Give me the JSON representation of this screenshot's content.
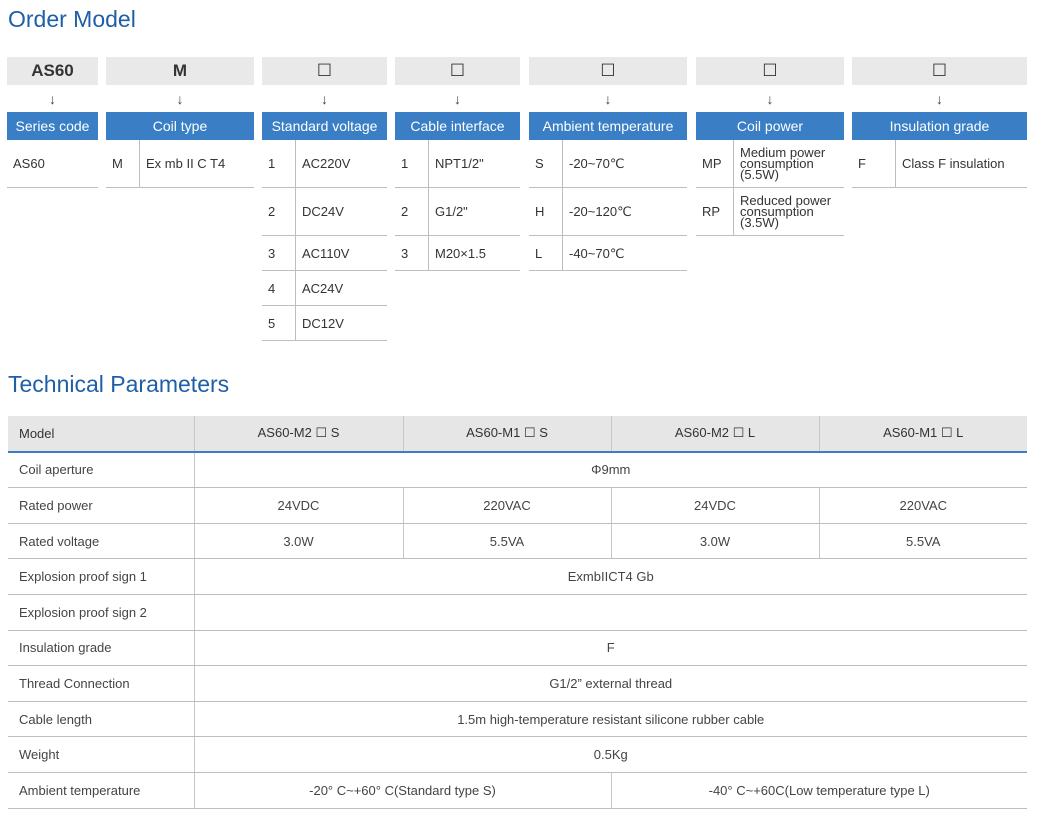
{
  "order_model": {
    "title": "Order Model",
    "arrow": "↓",
    "columns": [
      {
        "code": "AS60",
        "header": "Series code",
        "options": [
          {
            "code": "AS60",
            "desc": ""
          }
        ]
      },
      {
        "code": "M",
        "header": "Coil type",
        "options": [
          {
            "code": "M",
            "desc": "Ex mb II C T4"
          }
        ]
      },
      {
        "code": "☐",
        "header": "Standard voltage",
        "options": [
          {
            "code": "1",
            "desc": "AC220V"
          },
          {
            "code": "2",
            "desc": "DC24V"
          },
          {
            "code": "3",
            "desc": "AC110V"
          },
          {
            "code": "4",
            "desc": "AC24V"
          },
          {
            "code": "5",
            "desc": "DC12V"
          }
        ]
      },
      {
        "code": "☐",
        "header": "Cable interface",
        "options": [
          {
            "code": "1",
            "desc": "NPT1/2\""
          },
          {
            "code": "2",
            "desc": "G1/2\""
          },
          {
            "code": "3",
            "desc": "M20×1.5"
          }
        ]
      },
      {
        "code": "☐",
        "header": "Ambient temperature",
        "options": [
          {
            "code": "S",
            "desc": "-20~70℃"
          },
          {
            "code": "H",
            "desc": "-20~120℃"
          },
          {
            "code": "L",
            "desc": "-40~70℃"
          }
        ]
      },
      {
        "code": "☐",
        "header": "Coil power",
        "options": [
          {
            "code": "MP",
            "desc_lines": [
              "Medium power",
              "consumption",
              "(5.5W)"
            ]
          },
          {
            "code": "RP",
            "desc_lines": [
              "Reduced power",
              "consumption",
              "(3.5W)"
            ]
          }
        ]
      },
      {
        "code": "☐",
        "header": "Insulation grade",
        "options": [
          {
            "code": "F",
            "desc": "Class F insulation"
          }
        ]
      }
    ]
  },
  "technical": {
    "title": "Technical Parameters",
    "header": [
      "Model",
      "AS60-M2 ☐ S",
      "AS60-M1 ☐ S",
      "AS60-M2 ☐ L",
      "AS60-M1 ☐ L"
    ],
    "rows": [
      {
        "label": "Coil aperture",
        "cells": [
          {
            "text": "Φ9mm",
            "span": 4
          }
        ]
      },
      {
        "label": "Rated power",
        "cells": [
          {
            "text": "24VDC",
            "span": 1
          },
          {
            "text": "220VAC",
            "span": 1
          },
          {
            "text": "24VDC",
            "span": 1
          },
          {
            "text": "220VAC",
            "span": 1
          }
        ]
      },
      {
        "label": "Rated voltage",
        "cells": [
          {
            "text": "3.0W",
            "span": 1
          },
          {
            "text": "5.5VA",
            "span": 1
          },
          {
            "text": "3.0W",
            "span": 1
          },
          {
            "text": "5.5VA",
            "span": 1
          }
        ]
      },
      {
        "label": "Explosion proof sign 1",
        "cells": [
          {
            "text": "ExmbIICT4 Gb",
            "span": 4
          }
        ]
      },
      {
        "label": "Explosion proof sign 2",
        "cells": [
          {
            "text": "",
            "span": 4
          }
        ]
      },
      {
        "label": "Insulation grade",
        "cells": [
          {
            "text": "F",
            "span": 4
          }
        ]
      },
      {
        "label": "Thread Connection",
        "cells": [
          {
            "text": "G1/2” external thread",
            "span": 4
          }
        ]
      },
      {
        "label": "Cable length",
        "cells": [
          {
            "text": "1.5m high-temperature resistant silicone rubber cable",
            "span": 4
          }
        ]
      },
      {
        "label": "Weight",
        "cells": [
          {
            "text": "0.5Kg",
            "span": 4
          }
        ]
      },
      {
        "label": "Ambient temperature",
        "cells": [
          {
            "text": "-20° C~+60° C(Standard type S)",
            "span": 2
          },
          {
            "text": "-40° C~+60C(Low temperature type L)",
            "span": 2
          }
        ]
      }
    ]
  }
}
